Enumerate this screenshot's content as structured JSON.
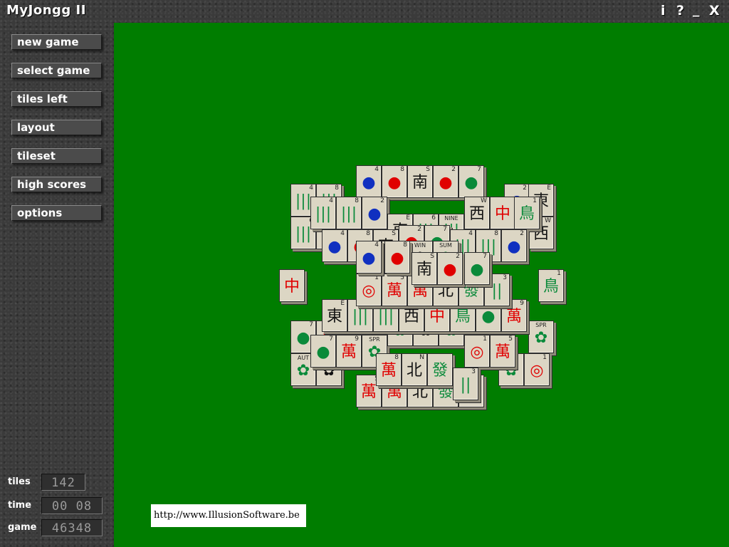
{
  "window": {
    "title": "MyJongg II",
    "buttons": [
      {
        "name": "info-button",
        "label": "i"
      },
      {
        "name": "help-button",
        "label": "?"
      },
      {
        "name": "minimize-button",
        "label": "_"
      },
      {
        "name": "close-button",
        "label": "X"
      }
    ]
  },
  "menu": [
    {
      "name": "new-game-button",
      "label": "new game"
    },
    {
      "name": "select-game-button",
      "label": "select game"
    },
    {
      "name": "tiles-left-button",
      "label": "tiles left"
    },
    {
      "name": "layout-button",
      "label": "layout"
    },
    {
      "name": "tileset-button",
      "label": "tileset"
    },
    {
      "name": "high-scores-button",
      "label": "high scores"
    },
    {
      "name": "options-button",
      "label": "options"
    }
  ],
  "stats": {
    "tiles_label": "tiles",
    "tiles_value": "142",
    "time_label": "time",
    "time_value": "00 08",
    "game_label": "game",
    "game_value": "46348"
  },
  "url": "http://www.IllusionSoftware.be",
  "tiles": [
    {
      "num": "4",
      "glyph": "|||",
      "color": "green"
    },
    {
      "num": "8",
      "glyph": "|||",
      "color": "green"
    },
    {
      "num": "2",
      "glyph": "●",
      "color": "blue"
    },
    {
      "num": "E",
      "glyph": "東",
      "color": "black"
    },
    {
      "num": "6",
      "glyph": "|||",
      "color": "green"
    },
    {
      "label": "NINE",
      "glyph": "|||",
      "color": "green"
    },
    {
      "num": "W",
      "glyph": "西",
      "color": "black"
    },
    {
      "glyph": "中",
      "color": "red"
    },
    {
      "num": "1",
      "glyph": "鳥",
      "color": "green"
    },
    {
      "num": "7",
      "glyph": "●",
      "color": "green"
    },
    {
      "num": "9",
      "glyph": "萬",
      "color": "red"
    },
    {
      "label": "SPR",
      "glyph": "✿",
      "color": "green"
    },
    {
      "label": "AUT",
      "glyph": "✿",
      "color": "green"
    },
    {
      "label": "WIN",
      "glyph": "✿",
      "color": "black"
    },
    {
      "label": "SUM",
      "glyph": "✿",
      "color": "green"
    },
    {
      "num": "1",
      "glyph": "◎",
      "color": "red"
    },
    {
      "num": "5",
      "glyph": "萬",
      "color": "red"
    },
    {
      "num": "8",
      "glyph": "萬",
      "color": "red"
    },
    {
      "num": "N",
      "glyph": "北",
      "color": "black"
    },
    {
      "glyph": "發",
      "color": "green"
    },
    {
      "num": "3",
      "glyph": "||",
      "color": "green"
    },
    {
      "num": "4",
      "glyph": "●",
      "color": "blue"
    },
    {
      "num": "8",
      "glyph": "●",
      "color": "red"
    },
    {
      "num": "S",
      "glyph": "南",
      "color": "black"
    },
    {
      "num": "2",
      "glyph": "●",
      "color": "red"
    },
    {
      "num": "7",
      "glyph": "●",
      "color": "green"
    }
  ]
}
